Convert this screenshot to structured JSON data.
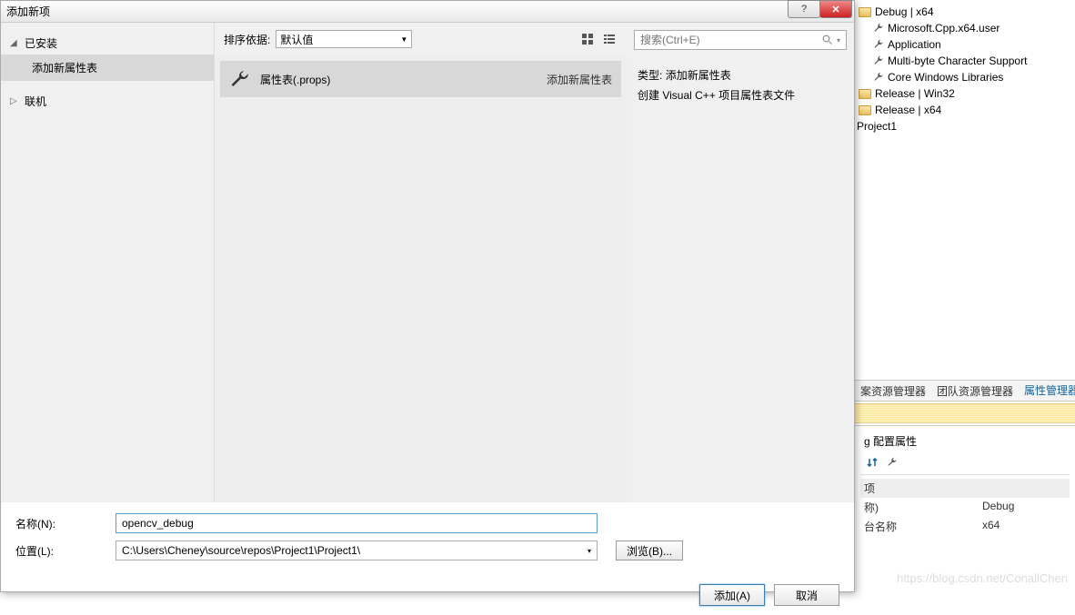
{
  "dialog": {
    "title": "添加新项",
    "tree": {
      "installed": "已安装",
      "prop_sheet": "添加新属性表",
      "online": "联机"
    },
    "sort": {
      "label": "排序依据:",
      "value": "默认值"
    },
    "item": {
      "name": "属性表(.props)",
      "tag": "添加新属性表"
    },
    "search": {
      "placeholder": "搜索(Ctrl+E)"
    },
    "desc": {
      "type_label": "类型:",
      "type_value": "添加新属性表",
      "line2": "创建 Visual C++ 项目属性表文件"
    },
    "form": {
      "name_label": "名称(N):",
      "name_value": "opencv_debug",
      "loc_label": "位置(L):",
      "loc_value": "C:\\Users\\Cheney\\source\\repos\\Project1\\Project1\\",
      "browse": "浏览(B)..."
    },
    "buttons": {
      "add": "添加(A)",
      "cancel": "取消"
    }
  },
  "bg": {
    "tree": {
      "debug_x64": "Debug | x64",
      "ms_cpp": "Microsoft.Cpp.x64.user",
      "app": "Application",
      "mbcs": "Multi-byte Character Support",
      "core": "Core Windows Libraries",
      "rel_win32": "Release | Win32",
      "rel_x64": "Release | x64",
      "project": "Project1"
    },
    "tabs": {
      "t1": "案资源管理器",
      "t2": "团队资源管理器",
      "t3": "属性管理器"
    },
    "props": {
      "header": "g 配置属性",
      "cat": "项",
      "k1": "称)",
      "v1": "Debug",
      "k2": "台名称",
      "v2": "x64"
    }
  },
  "watermark": "https://blog.csdn.net/ConallChen"
}
